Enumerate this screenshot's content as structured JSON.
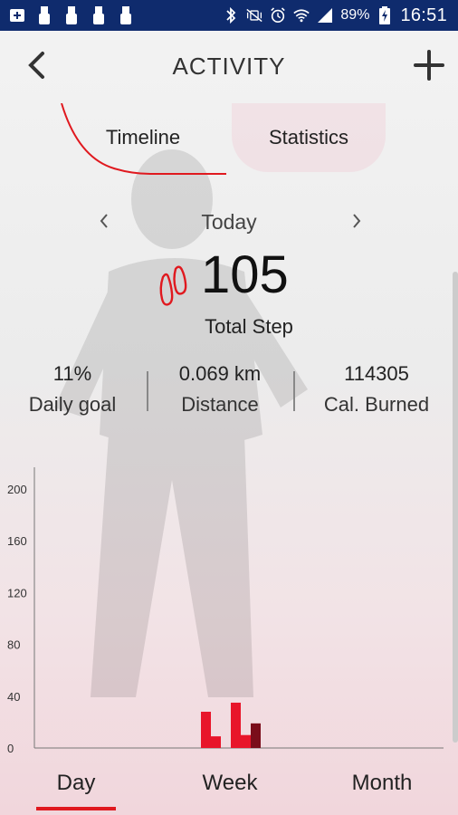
{
  "status_bar": {
    "battery": "89%",
    "time": "16:51",
    "icons": [
      "add-notification-icon",
      "usb-icon",
      "usb-icon",
      "usb-icon",
      "usb-icon",
      "bluetooth-icon",
      "mute-vibrate-icon",
      "alarm-icon",
      "wifi-icon",
      "signal-icon",
      "battery-charging-icon"
    ]
  },
  "header": {
    "title": "ACTIVITY",
    "back_icon": "back-chevron-icon",
    "add_icon": "plus-icon"
  },
  "tabs": [
    {
      "label": "Timeline",
      "active": true
    },
    {
      "label": "Statistics",
      "active": false
    }
  ],
  "day_selector": {
    "label": "Today",
    "prev_icon": "chevron-left-icon",
    "next_icon": "chevron-right-icon"
  },
  "steps": {
    "value": "105",
    "label": "Total Step",
    "icon": "footsteps-icon"
  },
  "stats": [
    {
      "value": "11%",
      "label": "Daily goal"
    },
    {
      "value": "0.069 km",
      "label": "Distance"
    },
    {
      "value": "114305",
      "label": "Cal. Burned"
    }
  ],
  "chart_data": {
    "type": "bar",
    "yticks": [
      "0",
      "40",
      "80",
      "120",
      "160",
      "200"
    ],
    "ylim": [
      0,
      200
    ],
    "bars": [
      {
        "x": 0,
        "value": 28,
        "color": "#e8152a"
      },
      {
        "x": 1,
        "value": 9,
        "color": "#e8152a"
      },
      {
        "x": 2,
        "value": 0,
        "color": "#e8152a"
      },
      {
        "x": 3,
        "value": 35,
        "color": "#e8152a"
      },
      {
        "x": 4,
        "value": 10,
        "color": "#e8152a"
      },
      {
        "x": 5,
        "value": 19,
        "color": "#7a0d1a"
      }
    ]
  },
  "bottom_tabs": [
    {
      "label": "Day",
      "active": true
    },
    {
      "label": "Week",
      "active": false
    },
    {
      "label": "Month",
      "active": false
    }
  ],
  "colors": {
    "status_bar": "#0f2b6d",
    "accent": "#e0191f",
    "bar_dark": "#7a0d1a"
  }
}
